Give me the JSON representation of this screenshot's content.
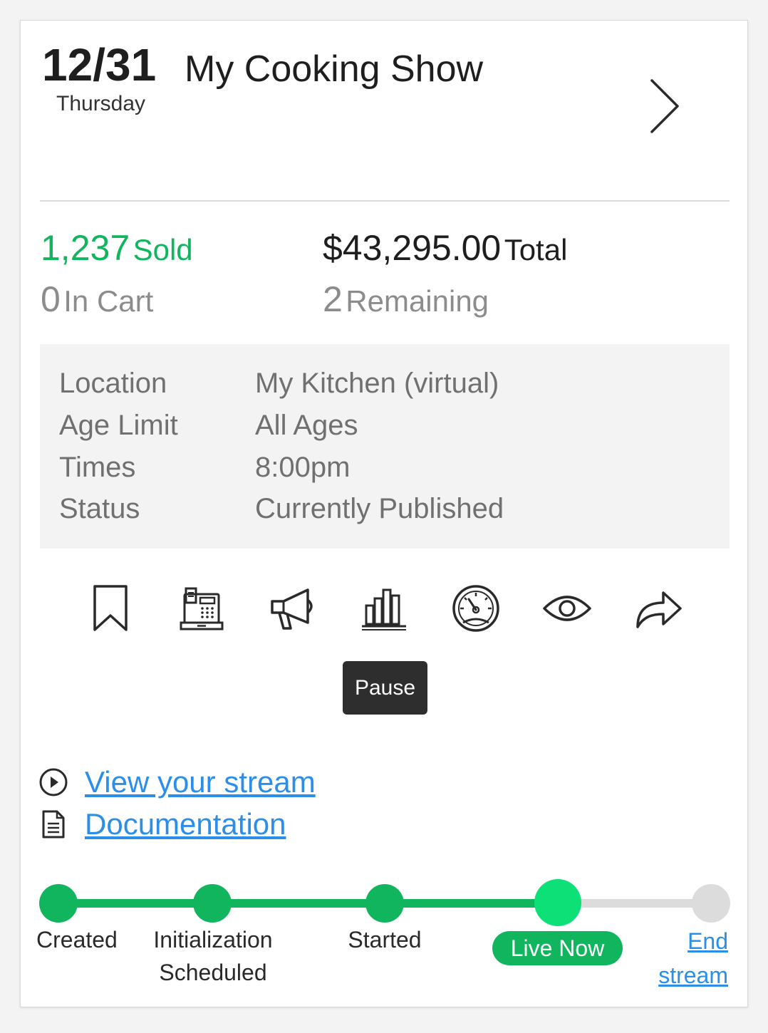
{
  "header": {
    "date": "12/31",
    "day": "Thursday",
    "title": "My Cooking Show"
  },
  "stats": {
    "sold_value": "1,237",
    "sold_label": "Sold",
    "total_value": "$43,295.00",
    "total_label": "Total",
    "cart_value": "0",
    "cart_label": "In Cart",
    "remaining_value": "2",
    "remaining_label": "Remaining"
  },
  "info": [
    {
      "key": "Location",
      "value": "My Kitchen (virtual)"
    },
    {
      "key": "Age Limit",
      "value": "All Ages"
    },
    {
      "key": "Times",
      "value": "8:00pm"
    },
    {
      "key": "Status",
      "value": "Currently Published"
    }
  ],
  "actions": [
    "bookmark-icon",
    "cash-register-icon",
    "megaphone-icon",
    "bar-chart-icon",
    "speedometer-icon",
    "eye-icon",
    "share-icon"
  ],
  "tooltip": "Pause",
  "links": {
    "view_stream": "View your stream",
    "documentation": "Documentation"
  },
  "progress": {
    "steps": [
      "Created",
      "Initialization",
      "Scheduled",
      "Started"
    ],
    "current": "Live Now",
    "end_line1": "End",
    "end_line2": "stream"
  },
  "colors": {
    "green": "#11b55e",
    "green_active": "#0de077",
    "link": "#2b8ee8",
    "inactive": "#dcdcdc"
  }
}
